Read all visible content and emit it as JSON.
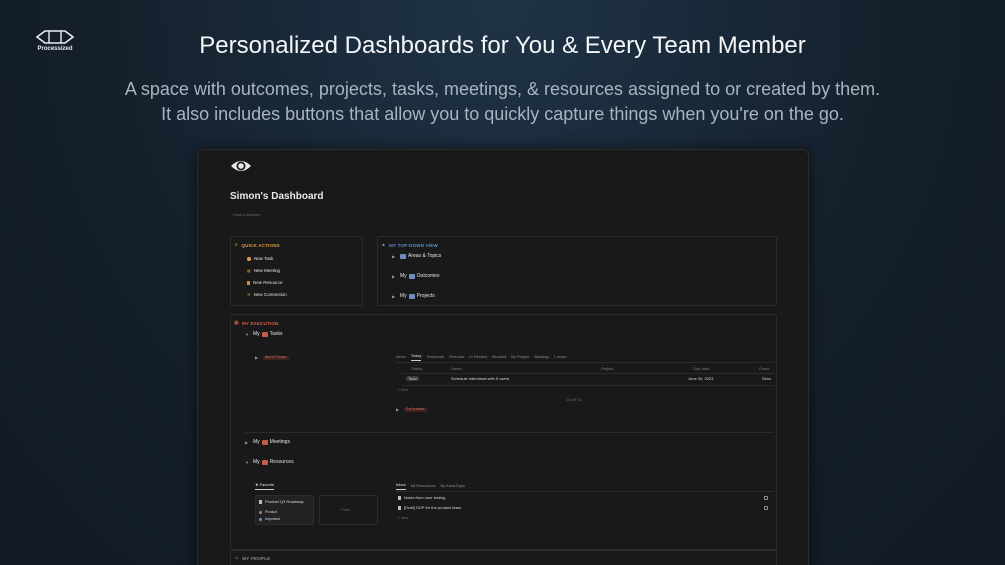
{
  "brand": {
    "logo_text": "Processized"
  },
  "hero": {
    "title": "Personalized Dashboards for You & Every Team Member",
    "subtitle_line1": "A space with outcomes, projects, tasks, meetings, & resources assigned to or created by them.",
    "subtitle_line2": "It also includes buttons that allow you to quickly capture things when you're on the go."
  },
  "page": {
    "title": "Simon's Dashboard",
    "add_property": "Add a property"
  },
  "quick_actions": {
    "heading": "QUICK ACTIONS",
    "items": [
      {
        "label": "New Task",
        "icon": "task-icon",
        "color": "#e0a24a"
      },
      {
        "label": "New Meeting",
        "icon": "meeting-icon",
        "color": "#c9882b"
      },
      {
        "label": "New Resource",
        "icon": "bookmark-icon",
        "color": "#d9892f"
      },
      {
        "label": "New Connection",
        "icon": "connection-icon",
        "color": "#c98a2e"
      }
    ]
  },
  "top_down": {
    "heading": "MY TOP-DOWN VIEW",
    "items": [
      {
        "prefix": "",
        "label": "Areas & Topics"
      },
      {
        "prefix": "My",
        "label": "Outcomes"
      },
      {
        "prefix": "My",
        "label": "Projects"
      }
    ]
  },
  "execution": {
    "heading": "MY EXECUTION",
    "tasks_prefix": "My",
    "tasks_label": "Tasks",
    "workflows_tag": "Workflows",
    "calendar_tag": "Calendar",
    "tabs": [
      "Inbox",
      "Today",
      "Tomorrow",
      "Overdue",
      "In Review",
      "Blocked",
      "By Project",
      "Backlog",
      "1 more..."
    ],
    "columns": [
      "Status",
      "Name",
      "Project",
      "Due date",
      "Owne"
    ],
    "rows": [
      {
        "status": "Todo",
        "name": "Schedule interviews with 5 users",
        "project": "",
        "due": "June 30, 2023",
        "owner": "Simo"
      }
    ],
    "new_label": "+ New",
    "count_label": "COUNT",
    "count_value": "1",
    "meetings_prefix": "My",
    "meetings_label": "Meetings",
    "resources_prefix": "My",
    "resources_label": "Resources"
  },
  "resources": {
    "favorite_tab": "Favorite",
    "card_title": "Product Q3 Roadmap",
    "card_tags": [
      "Product",
      "Important"
    ],
    "new_card": "+ New",
    "tabs": [
      "Inbox",
      "All Resources",
      "By Area/Topic"
    ],
    "items": [
      "Notes from user testing",
      "[Draft] SOP for the product team"
    ],
    "new_label": "+ New"
  },
  "people": {
    "heading": "MY PEOPLE"
  },
  "colors": {
    "accent_orange": "#e0a24a",
    "accent_blue": "#5b8fd6",
    "accent_red": "#d9604a"
  }
}
